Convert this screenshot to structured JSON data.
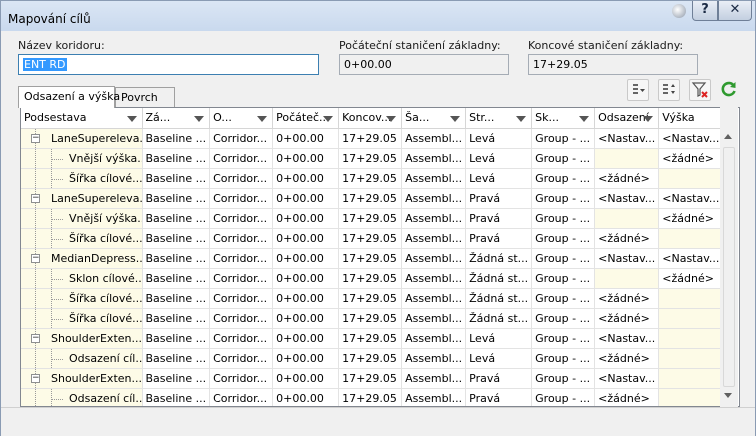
{
  "window": {
    "title": "Mapování cílů",
    "help_label": "?",
    "close_label": "✕"
  },
  "fields": {
    "corridor_label": "Název koridoru:",
    "corridor_value": "ENT RD",
    "start_label": "Počáteční staničení základny:",
    "start_value": "0+00.00",
    "end_label": "Koncové staničení základny:",
    "end_value": "17+29.05"
  },
  "toolbar_icons": [
    "filter-menu-icon",
    "sort-order-icon",
    "clear-filter-icon",
    "refresh-icon"
  ],
  "tabs": [
    {
      "label": "Odsazení a výška",
      "active": true
    },
    {
      "label": "Povrch",
      "active": false
    }
  ],
  "grid": {
    "columns": [
      "Podsestava",
      "Zá...",
      "O...",
      "Počáteč...",
      "Koncov...",
      "Ša...",
      "Str...",
      "Sk...",
      "Odsazení",
      "Výška"
    ],
    "rows": [
      {
        "level": 0,
        "cells": [
          "LaneSupereleva...",
          "Baseline ...",
          "Corridor...",
          "0+00.00",
          "17+29.05",
          "Assembl...",
          "Levá",
          "Group - ...",
          "<Nastav...",
          "<Nastav..."
        ]
      },
      {
        "level": 1,
        "cells": [
          "Vnější výška...",
          "Baseline ...",
          "Corridor...",
          "0+00.00",
          "17+29.05",
          "Assembl...",
          "Levá",
          "Group - ...",
          "",
          "<žádné>"
        ]
      },
      {
        "level": 1,
        "cells": [
          "Šířka cílové...",
          "Baseline ...",
          "Corridor...",
          "0+00.00",
          "17+29.05",
          "Assembl...",
          "Levá",
          "Group - ...",
          "<žádné>",
          ""
        ]
      },
      {
        "level": 0,
        "cells": [
          "LaneSupereleva...",
          "Baseline ...",
          "Corridor...",
          "0+00.00",
          "17+29.05",
          "Assembl...",
          "Pravá",
          "Group - ...",
          "<Nastav...",
          "<Nastav..."
        ]
      },
      {
        "level": 1,
        "cells": [
          "Vnější výška...",
          "Baseline ...",
          "Corridor...",
          "0+00.00",
          "17+29.05",
          "Assembl...",
          "Pravá",
          "Group - ...",
          "",
          "<žádné>"
        ]
      },
      {
        "level": 1,
        "cells": [
          "Šířka cílové...",
          "Baseline ...",
          "Corridor...",
          "0+00.00",
          "17+29.05",
          "Assembl...",
          "Pravá",
          "Group - ...",
          "<žádné>",
          ""
        ]
      },
      {
        "level": 0,
        "cells": [
          "MedianDepress...",
          "Baseline ...",
          "Corridor...",
          "0+00.00",
          "17+29.05",
          "Assembl...",
          "Žádná st...",
          "Group - ...",
          "<Nastav...",
          "<Nastav..."
        ]
      },
      {
        "level": 1,
        "cells": [
          "Sklon cílové...",
          "Baseline ...",
          "Corridor...",
          "0+00.00",
          "17+29.05",
          "Assembl...",
          "Žádná st...",
          "Group - ...",
          "",
          "<žádné>"
        ]
      },
      {
        "level": 1,
        "cells": [
          "Šířka cílové...",
          "Baseline ...",
          "Corridor...",
          "0+00.00",
          "17+29.05",
          "Assembl...",
          "Žádná st...",
          "Group - ...",
          "<žádné>",
          ""
        ]
      },
      {
        "level": 1,
        "cells": [
          "Šířka cílové...",
          "Baseline ...",
          "Corridor...",
          "0+00.00",
          "17+29.05",
          "Assembl...",
          "Žádná st...",
          "Group - ...",
          "<žádné>",
          ""
        ]
      },
      {
        "level": 0,
        "cells": [
          "ShoulderExten...",
          "Baseline ...",
          "Corridor...",
          "0+00.00",
          "17+29.05",
          "Assembl...",
          "Levá",
          "Group - ...",
          "<Nastav...",
          ""
        ]
      },
      {
        "level": 1,
        "cells": [
          "Odsazení cíl...",
          "Baseline ...",
          "Corridor...",
          "0+00.00",
          "17+29.05",
          "Assembl...",
          "Levá",
          "Group - ...",
          "<žádné>",
          ""
        ]
      },
      {
        "level": 0,
        "cells": [
          "ShoulderExten...",
          "Baseline ...",
          "Corridor...",
          "0+00.00",
          "17+29.05",
          "Assembl...",
          "Pravá",
          "Group - ...",
          "<Nastav...",
          ""
        ]
      },
      {
        "level": 1,
        "cells": [
          "Odsazení cíl...",
          "Baseline ...",
          "Corridor...",
          "0+00.00",
          "17+29.05",
          "Assembl...",
          "Pravá",
          "Group - ...",
          "<žádné>",
          ""
        ]
      }
    ]
  },
  "colors": {
    "highlight_cell": "#fdfbe7",
    "selection": "#3399ff",
    "title_bar": "#c9d9ee"
  }
}
